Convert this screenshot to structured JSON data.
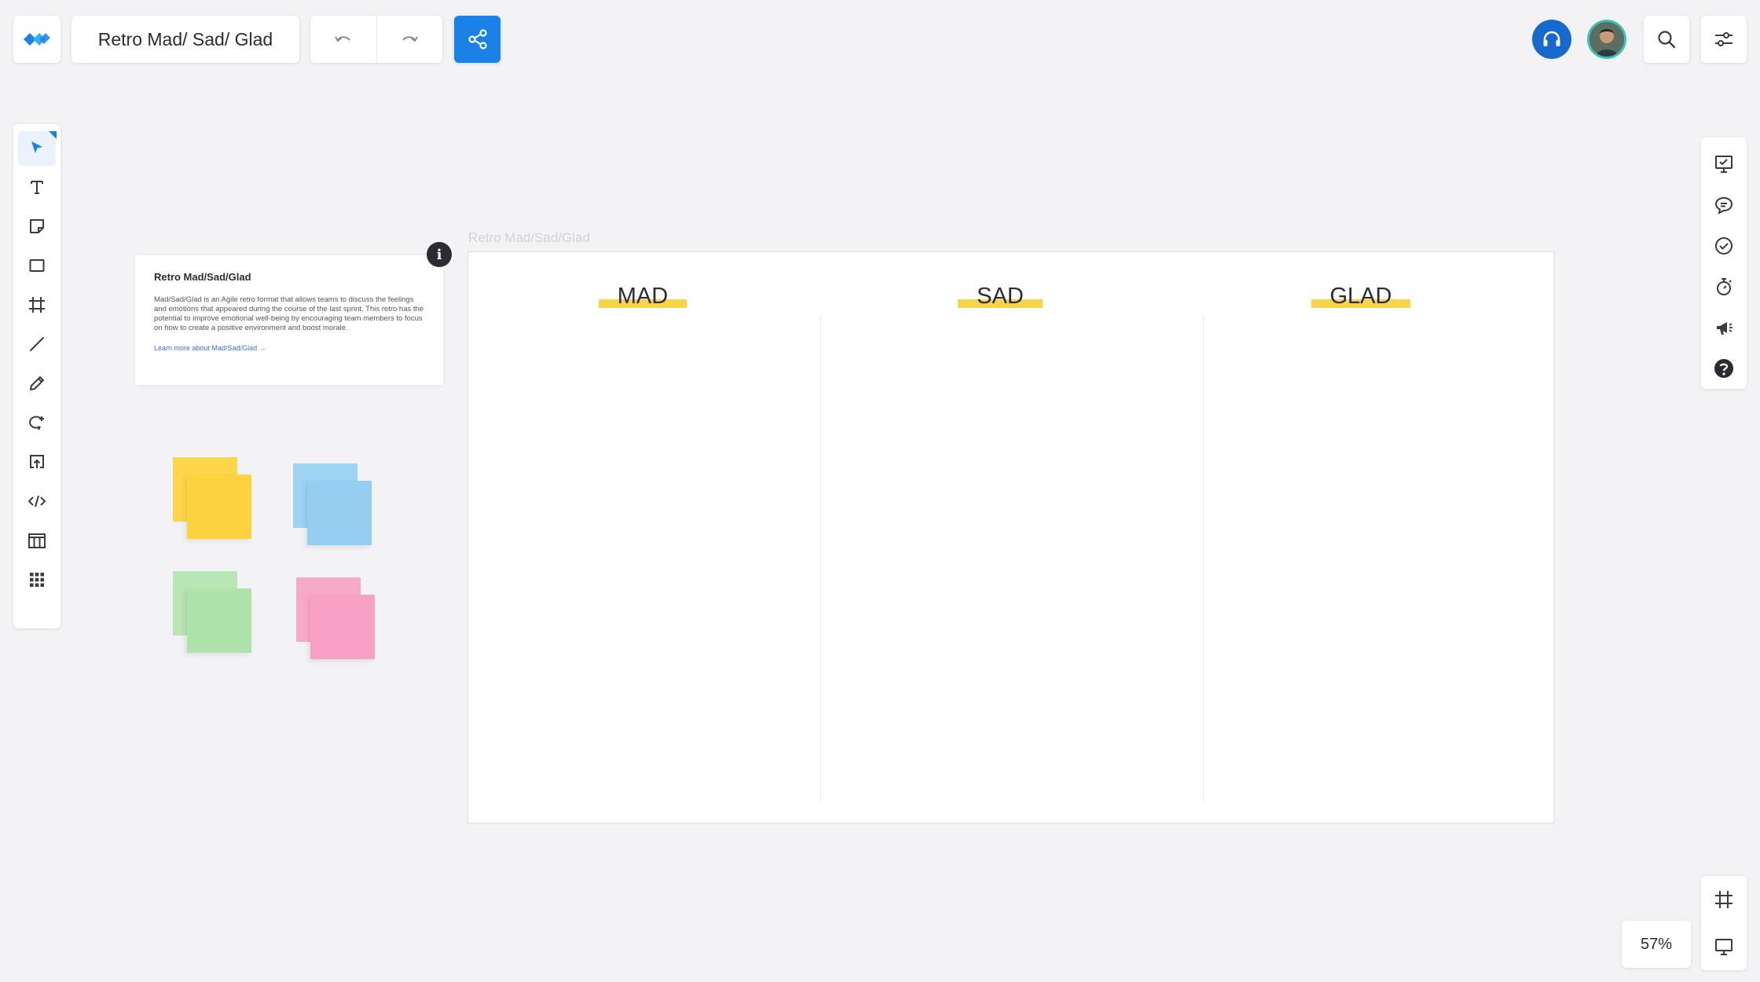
{
  "app": {
    "board_title": "Retro Mad/ Sad/ Glad",
    "zoom_level": "57%",
    "accent_color": "#1a82e6"
  },
  "top_bar": {
    "logo_icon": "app-logo-icon",
    "undo_icon": "undo-icon",
    "redo_icon": "redo-icon",
    "share_icon": "share-icon",
    "headset_icon": "headset-icon",
    "search_icon": "search-icon",
    "settings_icon": "settings-sliders-icon"
  },
  "left_toolbar": {
    "tools": [
      {
        "name": "select",
        "icon": "select-arrow-icon",
        "active": true
      },
      {
        "name": "text",
        "icon": "text-icon"
      },
      {
        "name": "sticky-note",
        "icon": "sticky-note-icon"
      },
      {
        "name": "shape",
        "icon": "rectangle-icon"
      },
      {
        "name": "frame",
        "icon": "frame-icon"
      },
      {
        "name": "line",
        "icon": "line-icon"
      },
      {
        "name": "pen",
        "icon": "pen-icon"
      },
      {
        "name": "comment-shape",
        "icon": "lasso-icon"
      },
      {
        "name": "upload",
        "icon": "upload-icon"
      },
      {
        "name": "embed",
        "icon": "code-icon"
      },
      {
        "name": "templates",
        "icon": "templates-icon"
      },
      {
        "name": "apps",
        "icon": "grid-icon"
      }
    ]
  },
  "right_toolbar": {
    "tools": [
      {
        "name": "present",
        "icon": "presentation-icon"
      },
      {
        "name": "comments",
        "icon": "comment-icon"
      },
      {
        "name": "tasks",
        "icon": "check-circle-icon"
      },
      {
        "name": "timer",
        "icon": "timer-icon"
      },
      {
        "name": "announce",
        "icon": "megaphone-icon"
      },
      {
        "name": "help",
        "icon": "help-icon"
      }
    ],
    "bottom": [
      {
        "name": "frames",
        "icon": "frame-icon"
      },
      {
        "name": "present-mode",
        "icon": "screen-icon"
      }
    ]
  },
  "info_card": {
    "title": "Retro Mad/Sad/Glad",
    "body": "Mad/Sad/Glad is an Agile retro format that allows teams to discuss the feelings and emotions that appeared during the course of the last sprint. This retro has the potential to improve emotional well-being by encouraging team members to focus on how to create a positive environment and boost morale.",
    "link": "Learn more about Mad/Sad/Glad →"
  },
  "sticky_stacks": [
    {
      "color": "yellow",
      "hex_back": "#fdd749",
      "hex_front": "#fcd23f"
    },
    {
      "color": "blue",
      "hex_back": "#9dd3f3",
      "hex_front": "#94cff1"
    },
    {
      "color": "green",
      "hex_back": "#b8e6b5",
      "hex_front": "#aee3ab"
    },
    {
      "color": "pink",
      "hex_back": "#f9a9c8",
      "hex_front": "#f7a2c4"
    }
  ],
  "board": {
    "frame_label": "Retro Mad/Sad/Glad",
    "columns": [
      {
        "label": "MAD"
      },
      {
        "label": "SAD"
      },
      {
        "label": "GLAD"
      }
    ],
    "highlight_color": "#f8d548"
  }
}
